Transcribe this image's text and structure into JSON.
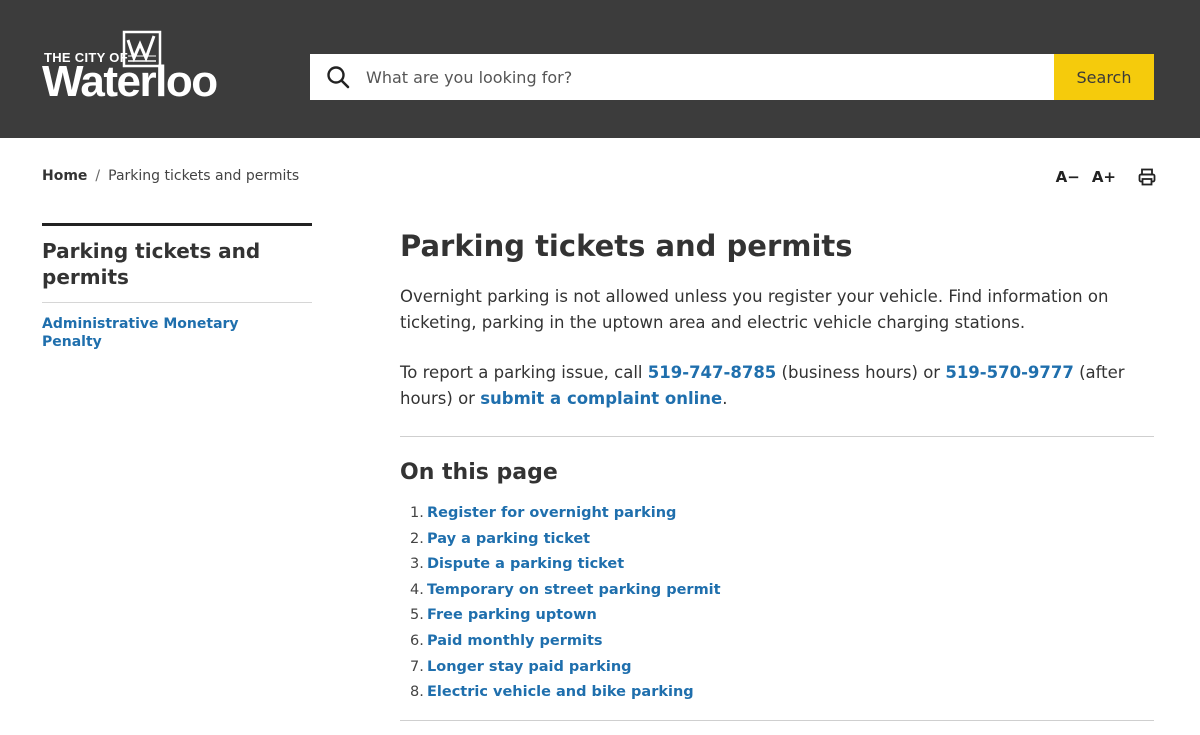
{
  "header": {
    "logo_small": "THE CITY OF",
    "logo_big": "Waterloo",
    "search_placeholder": "What are you looking for?",
    "search_button": "Search"
  },
  "breadcrumb": {
    "home": "Home",
    "separator": "/",
    "current": "Parking tickets and permits"
  },
  "tools": {
    "decrease": "A−",
    "increase": "A+"
  },
  "sidebar": {
    "title": "Parking tickets and permits",
    "links": [
      "Administrative Monetary Penalty"
    ]
  },
  "main": {
    "title": "Parking tickets and permits",
    "intro": "Overnight parking is not allowed unless you register your vehicle. Find information on ticketing, parking in the uptown area and electric vehicle charging stations.",
    "report": {
      "text1": "To report a parking issue, call ",
      "phone1": "519-747-8785",
      "text2": " (business hours) or ",
      "phone2": "519-570-9777",
      "text3": " (after hours) or ",
      "link": "submit a complaint online",
      "text4": "."
    },
    "on_this_page": "On this page",
    "toc": [
      {
        "num": "1.",
        "label": "Register for overnight parking"
      },
      {
        "num": "2.",
        "label": "Pay a parking ticket"
      },
      {
        "num": "3.",
        "label": "Dispute a parking ticket"
      },
      {
        "num": "4.",
        "label": "Temporary on street parking permit"
      },
      {
        "num": "5.",
        "label": "Free parking uptown"
      },
      {
        "num": "6.",
        "label": "Paid monthly permits"
      },
      {
        "num": "7.",
        "label": "Longer stay paid parking"
      },
      {
        "num": "8.",
        "label": "Electric vehicle and bike parking"
      }
    ]
  },
  "colors": {
    "header_bg": "#3c3c3c",
    "search_button_bg": "#f5cb0c",
    "link": "#1f6fad"
  },
  "icons": [
    "waterloo-logo-mark",
    "search-icon",
    "print-icon"
  ]
}
